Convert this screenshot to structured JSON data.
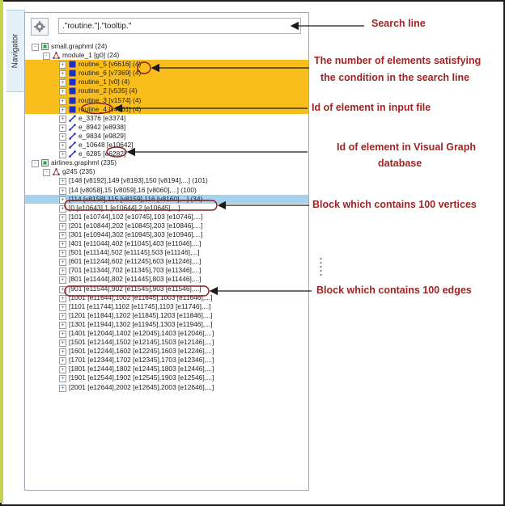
{
  "navigator_tab_label": "Navigator",
  "search": {
    "value": ".\"routine.\"|.\"tooltip.\""
  },
  "tree": [
    {
      "label": "small.graphml (24)",
      "level": 0,
      "icon": "graph-file-icon",
      "state": "-"
    },
    {
      "label": "module_1 [g0] (24)",
      "level": 1,
      "icon": "graph-icon",
      "state": "-"
    },
    {
      "label": "routine_5 [v6616] (4)",
      "level": 2,
      "icon": "vertex-icon",
      "state": "+",
      "hl": "y"
    },
    {
      "label": "routine_6 [v7369] (4)",
      "level": 2,
      "icon": "vertex-icon",
      "state": "+",
      "hl": "y"
    },
    {
      "label": "routine_1 [v0] (4)",
      "level": 2,
      "icon": "vertex-icon",
      "state": "+",
      "hl": "y"
    },
    {
      "label": "routine_2 [v535] (4)",
      "level": 2,
      "icon": "vertex-icon",
      "state": "+",
      "hl": "y"
    },
    {
      "label": "routine_3 [v1574] (4)",
      "level": 2,
      "icon": "vertex-icon",
      "state": "+",
      "hl": "y"
    },
    {
      "label": "routine_4 [v4661] (4)",
      "level": 2,
      "icon": "vertex-icon",
      "state": "+",
      "hl": "y"
    },
    {
      "label": "e_3376 [e3374]",
      "level": 2,
      "icon": "edge-icon",
      "state": "+"
    },
    {
      "label": "e_8942 [e8938]",
      "level": 2,
      "icon": "edge-icon",
      "state": "+"
    },
    {
      "label": "e_9834 [e9829]",
      "level": 2,
      "icon": "edge-icon",
      "state": "+"
    },
    {
      "label": "e_10648 [e10642]",
      "level": 2,
      "icon": "edge-icon",
      "state": "+"
    },
    {
      "label": "e_6285 [e6282]",
      "level": 2,
      "icon": "edge-icon",
      "state": "+"
    },
    {
      "label": "airlines.graphml (235)",
      "level": 0,
      "icon": "graph-file-icon",
      "state": "-"
    },
    {
      "label": "g245 (235)",
      "level": 1,
      "icon": "graph-icon",
      "state": "-"
    },
    {
      "label": "[148 [v8192],149 [v8193],150 [v8194],...] (101)",
      "level": 2,
      "state": "+"
    },
    {
      "label": "[14 [v8058],15 [v8059],16 [v8060],...] (100)",
      "level": 2,
      "state": "+"
    },
    {
      "label": "[114 [v8158],115 [v8159],116 [v8160],...] (34)",
      "level": 2,
      "state": "+",
      "hl": "sel"
    },
    {
      "label": "[0 [e10643],1 [e10644],2 [e10645],...]",
      "level": 2,
      "state": "+"
    },
    {
      "label": "[101 [e10744],102 [e10745],103 [e10746],...]",
      "level": 2,
      "state": "+"
    },
    {
      "label": "[201 [e10844],202 [e10845],203 [e10846],...]",
      "level": 2,
      "state": "+"
    },
    {
      "label": "[301 [e10944],302 [e10945],303 [e10946],...]",
      "level": 2,
      "state": "+"
    },
    {
      "label": "[401 [e11044],402 [e11045],403 [e11046],...]",
      "level": 2,
      "state": "+"
    },
    {
      "label": "[501 [e11144],502 [e11145],503 [e11146],...]",
      "level": 2,
      "state": "+"
    },
    {
      "label": "[601 [e11244],602 [e11245],603 [e11246],...]",
      "level": 2,
      "state": "+"
    },
    {
      "label": "[701 [e11344],702 [e11345],703 [e11346],...]",
      "level": 2,
      "state": "+"
    },
    {
      "label": "[801 [e11444],802 [e11445],803 [e11446],...]",
      "level": 2,
      "state": "+"
    },
    {
      "label": "[901 [e11544],902 [e11545],903 [e11546],...]",
      "level": 2,
      "state": "+"
    },
    {
      "label": "[1001 [e11644],1002 [e11645],1003 [e11646],...]",
      "level": 2,
      "state": "+"
    },
    {
      "label": "[1101 [e11744],1102 [e11745],1103 [e11746],...]",
      "level": 2,
      "state": "+"
    },
    {
      "label": "[1201 [e11844],1202 [e11845],1203 [e11846],...]",
      "level": 2,
      "state": "+"
    },
    {
      "label": "[1301 [e11944],1302 [e11945],1303 [e11946],...]",
      "level": 2,
      "state": "+"
    },
    {
      "label": "[1401 [e12044],1402 [e12045],1403 [e12046],...]",
      "level": 2,
      "state": "+"
    },
    {
      "label": "[1501 [e12144],1502 [e12145],1503 [e12146],...]",
      "level": 2,
      "state": "+"
    },
    {
      "label": "[1601 [e12244],1602 [e12245],1603 [e12246],...]",
      "level": 2,
      "state": "+"
    },
    {
      "label": "[1701 [e12344],1702 [e12345],1703 [e12346],...]",
      "level": 2,
      "state": "+"
    },
    {
      "label": "[1801 [e12444],1802 [e12445],1803 [e12446],...]",
      "level": 2,
      "state": "+"
    },
    {
      "label": "[1901 [e12544],1902 [e12545],1903 [e12546],...]",
      "level": 2,
      "state": "+"
    },
    {
      "label": "[2001 [e12644],2002 [e12645],2003 [e12646],...]",
      "level": 2,
      "state": "+"
    }
  ],
  "annotations": {
    "search_line": "Search line",
    "count_line1": "The number of elements satisfying",
    "count_line2": "the condition in the search line",
    "input_id": "Id of element in input file",
    "db_id_line1": "Id of element in Visual Graph",
    "db_id_line2": "database",
    "vertex_block": "Block which contains 100 vertices",
    "edge_block": "Block which contains 100 edges"
  },
  "colors": {
    "highlight": "#f9bd1c",
    "selection": "#a6d2ee",
    "annotation": "#a02424",
    "frame_accent": "#c5d24e",
    "vertex_icon": "#1f2fc4"
  }
}
